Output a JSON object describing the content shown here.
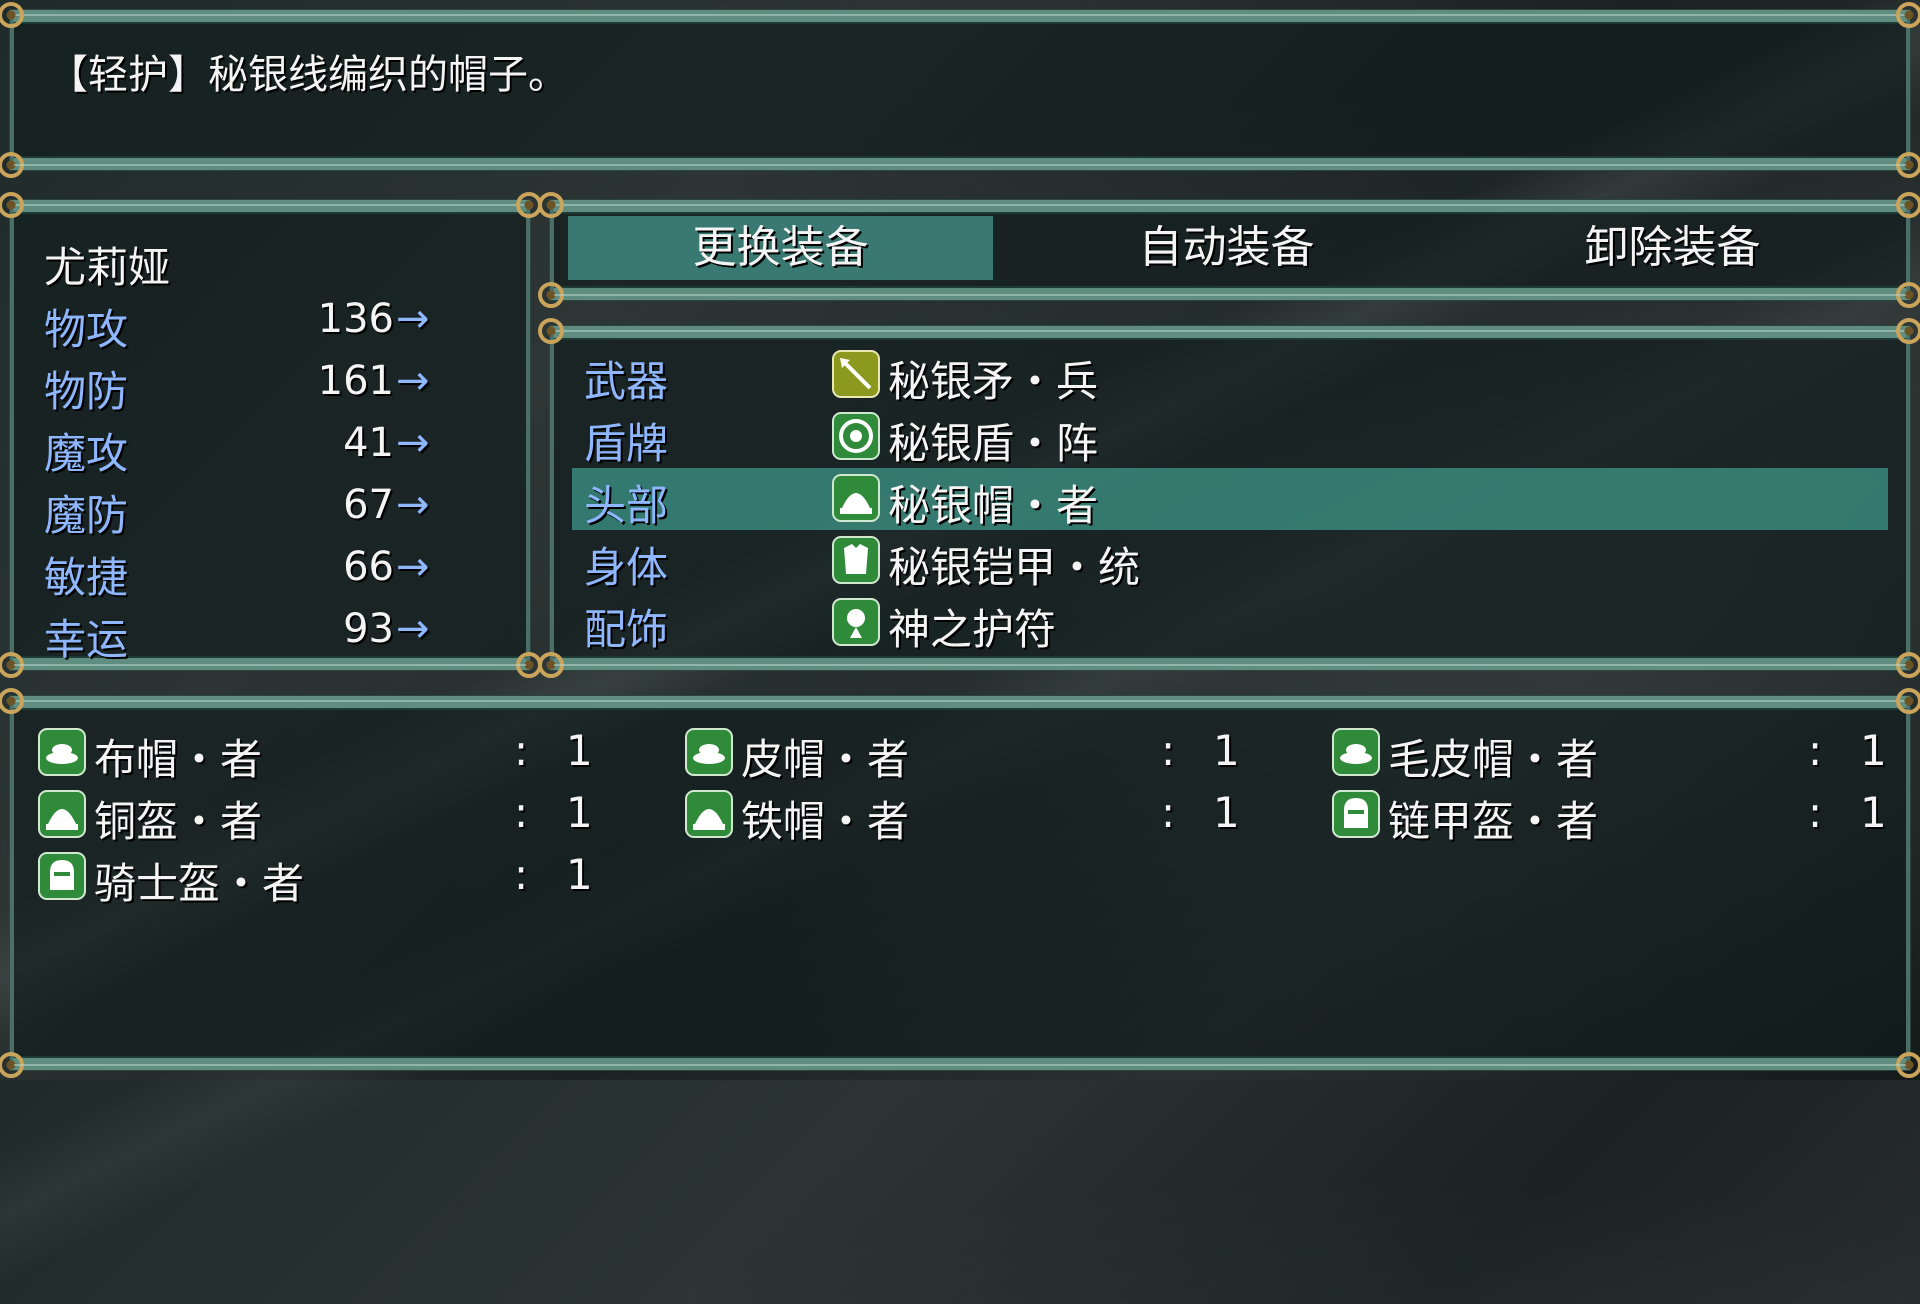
{
  "help": {
    "text": "【轻护】秘银线编织的帽子。"
  },
  "actor": {
    "name": "尤莉娅",
    "stats": [
      {
        "label": "物攻",
        "value": "136"
      },
      {
        "label": "物防",
        "value": "161"
      },
      {
        "label": "魔攻",
        "value": "41"
      },
      {
        "label": "魔防",
        "value": "67"
      },
      {
        "label": "敏捷",
        "value": "66"
      },
      {
        "label": "幸运",
        "value": "93"
      }
    ],
    "arrow": "→"
  },
  "commands": [
    {
      "label": "更换装备",
      "selected": true
    },
    {
      "label": "自动装备",
      "selected": false
    },
    {
      "label": "卸除装备",
      "selected": false
    }
  ],
  "slots": [
    {
      "label": "武器",
      "item": "秘银矛・兵",
      "icon": "spear-icon"
    },
    {
      "label": "盾牌",
      "item": "秘银盾・阵",
      "icon": "shield-icon"
    },
    {
      "label": "头部",
      "item": "秘银帽・者",
      "icon": "helmet-icon",
      "selected": true
    },
    {
      "label": "身体",
      "item": "秘银铠甲・统",
      "icon": "armor-icon"
    },
    {
      "label": "配饰",
      "item": "神之护符",
      "icon": "amulet-icon"
    }
  ],
  "items": [
    {
      "name": "布帽・者",
      "colon": ":",
      "count": "1",
      "icon": "cap-icon"
    },
    {
      "name": "皮帽・者",
      "colon": ":",
      "count": "1",
      "icon": "cap-icon"
    },
    {
      "name": "毛皮帽・者",
      "colon": ":",
      "count": "1",
      "icon": "cap-icon"
    },
    {
      "name": "铜盔・者",
      "colon": ":",
      "count": "1",
      "icon": "helmet-icon"
    },
    {
      "name": "铁帽・者",
      "colon": ":",
      "count": "1",
      "icon": "helmet-icon"
    },
    {
      "name": "链甲盔・者",
      "colon": ":",
      "count": "1",
      "icon": "knight-helm-icon"
    },
    {
      "name": "骑士盔・者",
      "colon": ":",
      "count": "1",
      "icon": "knight-helm-icon"
    }
  ],
  "colors": {
    "frame": "#5f8e80",
    "highlight": "#46968c",
    "label_blue": "#8fb7ff",
    "icon_green": "#2f8a3a",
    "icon_yellow": "#8b9a1e"
  }
}
